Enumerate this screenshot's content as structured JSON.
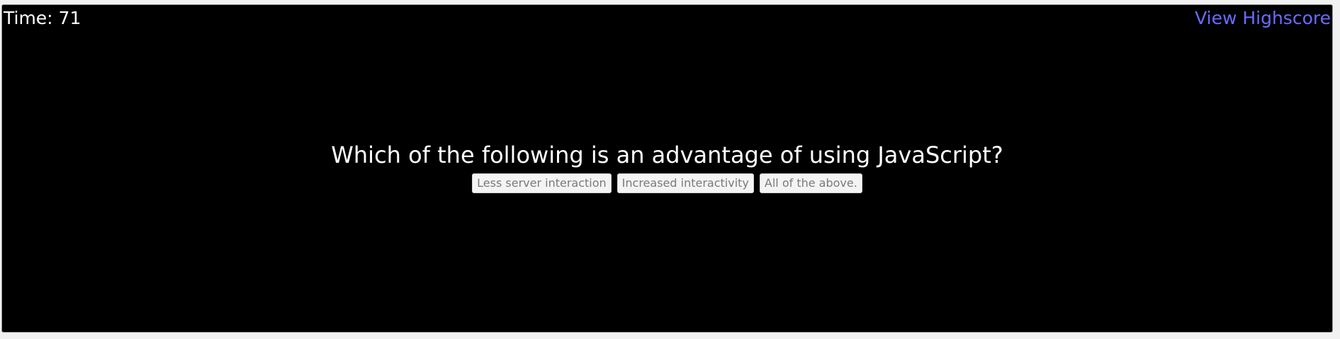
{
  "header": {
    "timer_text": "Time: 71",
    "highscore_link": "View Highscore"
  },
  "quiz": {
    "question": "Which of the following is an advantage of using JavaScript?",
    "choices": [
      {
        "label": "Less server interaction"
      },
      {
        "label": "Increased interactivity"
      },
      {
        "label": "All of the above."
      }
    ]
  },
  "colors": {
    "background": "#000000",
    "text": "#ffffff",
    "link": "#6b6bff",
    "button_bg": "#f4f4f4",
    "button_text": "#7a7a7a"
  }
}
